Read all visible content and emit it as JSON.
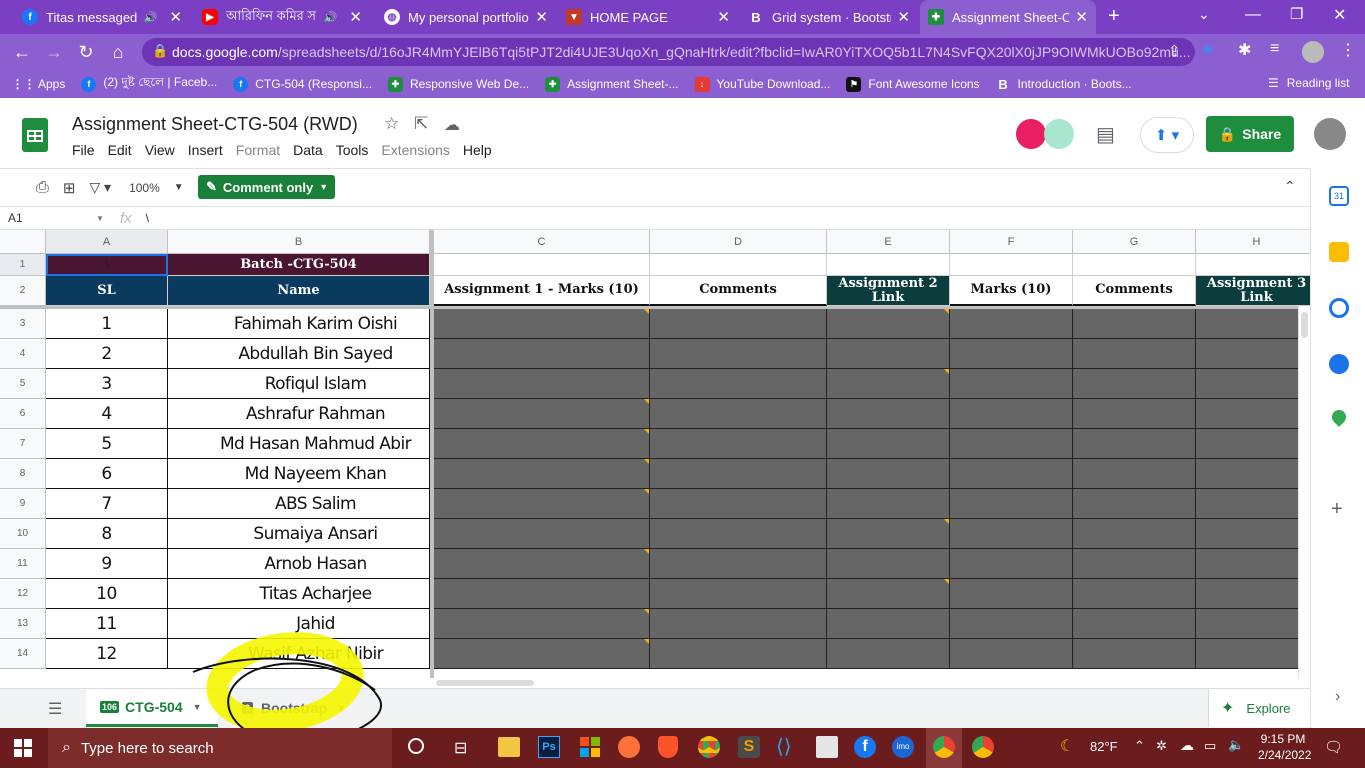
{
  "browser": {
    "tabs": [
      {
        "title": "Titas messaged yo",
        "icon": "facebook-icon",
        "audio": true
      },
      {
        "title": "আরিফিন কমির স",
        "icon": "youtube-icon",
        "audio": true
      },
      {
        "title": "My personal portfolio",
        "icon": "globe-icon",
        "audio": false
      },
      {
        "title": "HOME PAGE",
        "icon": "page-icon",
        "audio": false
      },
      {
        "title": "Grid system · Bootstra",
        "icon": "bootstrap-icon",
        "audio": false
      },
      {
        "title": "Assignment Sheet-CTG",
        "icon": "sheets-icon",
        "audio": false
      }
    ],
    "url_host": "docs.google.com",
    "url_path": "/spreadsheets/d/16oJR4MmYJElB6Tqi5tPJT2di4UJE3UqoXn_gQnaHtrk/edit?fbclid=IwAR0YiTXOQ5b1L7N4SvFQX20lX0jJP9OIWMkUOBo92mu...",
    "bookmarks": [
      {
        "label": "Apps",
        "icon": "apps-grid-icon"
      },
      {
        "label": "(2) দুষ্ট ছেলে | Faceb...",
        "icon": "facebook-icon"
      },
      {
        "label": "CTG-504 (Responsi...",
        "icon": "facebook-icon"
      },
      {
        "label": "Responsive Web De...",
        "icon": "sheets-icon"
      },
      {
        "label": "Assignment Sheet-...",
        "icon": "sheets-icon"
      },
      {
        "label": "YouTube Download...",
        "icon": "download-icon"
      },
      {
        "label": "Font Awesome Icons",
        "icon": "flag-icon"
      },
      {
        "label": "Introduction · Boots...",
        "icon": "bootstrap-icon"
      }
    ],
    "reading_list": "Reading list"
  },
  "sheet": {
    "title": "Assignment Sheet-CTG-504 (RWD)",
    "menu": [
      "File",
      "Edit",
      "View",
      "Insert",
      "Format",
      "Data",
      "Tools",
      "Extensions",
      "Help"
    ],
    "menu_disabled": [
      "Format",
      "Extensions"
    ],
    "share_label": "Share",
    "zoom": "100%",
    "comment_only": "Comment only",
    "cell_ref": "A1",
    "formula": "\\",
    "columns": [
      "A",
      "B",
      "C",
      "D",
      "E",
      "F",
      "G",
      "H"
    ],
    "row1": {
      "a": "\\",
      "b": "Batch -CTG-504"
    },
    "headers": {
      "sl": "SL",
      "name": "Name",
      "c": "Assignment 1 - Marks (10)",
      "d": "Comments",
      "e": "Assignment 2 Link",
      "f": "Marks (10)",
      "g": "Comments",
      "h": "Assignment 3 Link"
    },
    "rows": [
      {
        "n": "3",
        "sl": "1",
        "name": "Fahimah Karim Oishi"
      },
      {
        "n": "4",
        "sl": "2",
        "name": "Abdullah Bin Sayed"
      },
      {
        "n": "5",
        "sl": "3",
        "name": "Rofiqul Islam"
      },
      {
        "n": "6",
        "sl": "4",
        "name": "Ashrafur Rahman"
      },
      {
        "n": "7",
        "sl": "5",
        "name": "Md Hasan Mahmud Abir"
      },
      {
        "n": "8",
        "sl": "6",
        "name": "Md Nayeem Khan"
      },
      {
        "n": "9",
        "sl": "7",
        "name": "ABS Salim"
      },
      {
        "n": "10",
        "sl": "8",
        "name": "Sumaiya Ansari"
      },
      {
        "n": "11",
        "sl": "9",
        "name": "Arnob Hasan"
      },
      {
        "n": "12",
        "sl": "10",
        "name": "Titas Acharjee"
      },
      {
        "n": "13",
        "sl": "11",
        "name": "Jahid"
      },
      {
        "n": "14",
        "sl": "12",
        "name": "Wasif Azhar Nibir"
      }
    ],
    "tabs": [
      {
        "label": "CTG-504",
        "badge": "106",
        "active": true
      },
      {
        "label": "Bootstrap",
        "badge": "3",
        "active": false
      }
    ],
    "explore": "Explore"
  },
  "taskbar": {
    "search_placeholder": "Type here to search",
    "weather": "82°F",
    "time": "9:15 PM",
    "date": "2/24/2022"
  },
  "colors": {
    "chrome_purple": "#8b5fd0",
    "maroon_header": "#4a1530",
    "navy_header": "#0b3a5f",
    "teal_header": "#0b3d3d",
    "empty_cell": "#666666",
    "sheets_green": "#1e8e3e",
    "highlight": "#f5f500"
  }
}
